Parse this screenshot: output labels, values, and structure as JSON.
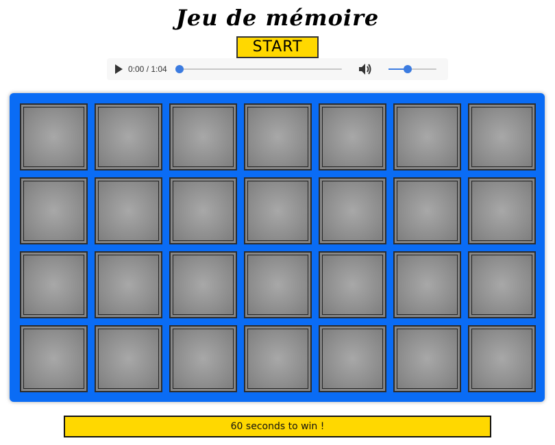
{
  "title": "Jeu de mémoire",
  "start_button": {
    "label": "START"
  },
  "audio": {
    "time_display": "0:00 / 1:04",
    "progress": 0.0,
    "volume": 0.4
  },
  "board": {
    "rows": 4,
    "columns": 7,
    "card_state": "face-down"
  },
  "status": {
    "message": "60 seconds to win !"
  },
  "colors": {
    "board": "#0a6cf5",
    "accent": "#ffd800",
    "card": "#9a9a9a",
    "slider": "#3b7be0"
  }
}
